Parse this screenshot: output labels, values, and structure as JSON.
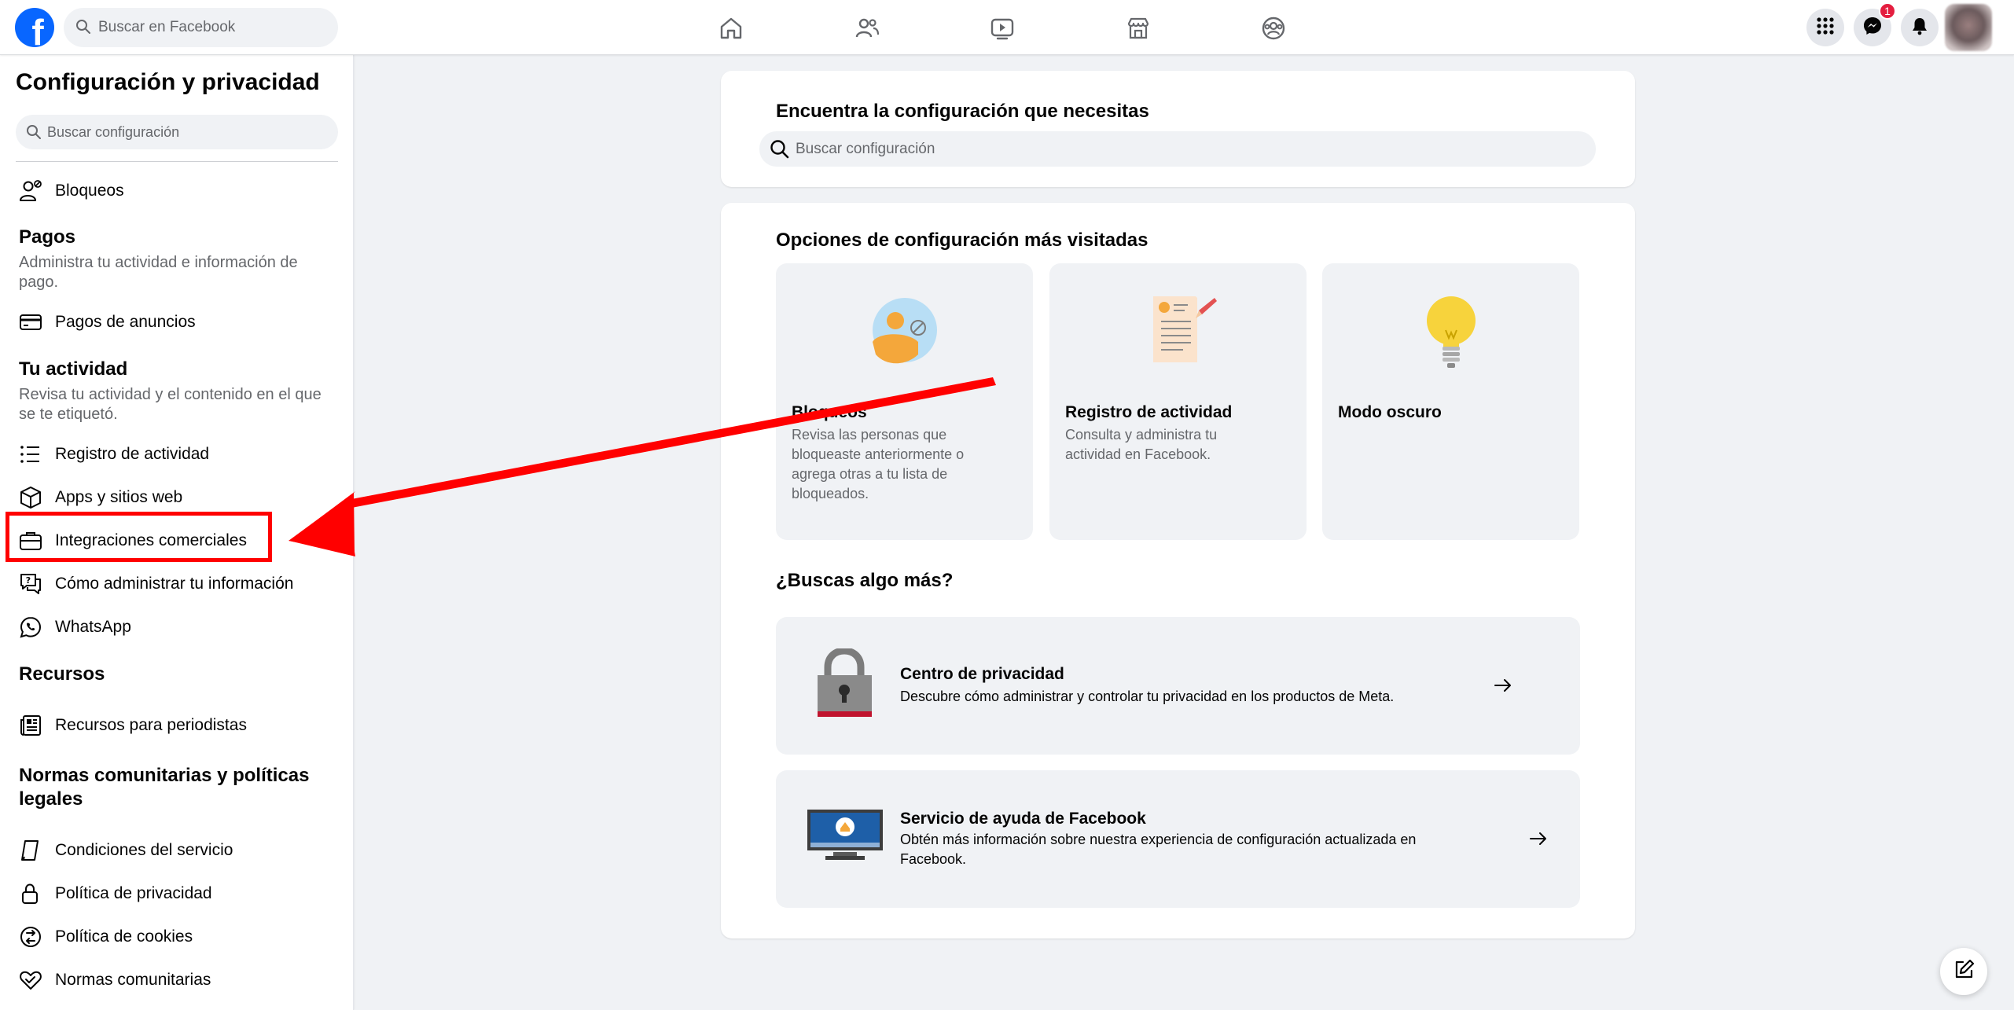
{
  "topbar": {
    "search_placeholder": "Buscar en Facebook",
    "messenger_badge": "1",
    "nav_icons": [
      "home-icon",
      "friends-icon",
      "video-icon",
      "marketplace-icon",
      "groups-icon"
    ]
  },
  "sidebar": {
    "title": "Configuración y privacidad",
    "search_placeholder": "Buscar configuración",
    "items": {
      "bloqueos": "Bloqueos",
      "pagos_section": "Pagos",
      "pagos_desc": "Administra tu actividad e información de pago.",
      "pagos_anuncios": "Pagos de anuncios",
      "actividad_section": "Tu actividad",
      "actividad_desc": "Revisa tu actividad y el contenido en el que se te etiquetó.",
      "registro": "Registro de actividad",
      "apps": "Apps y sitios web",
      "integraciones": "Integraciones comerciales",
      "como_administrar": "Cómo administrar tu información",
      "whatsapp": "WhatsApp",
      "recursos_section": "Recursos",
      "recursos_periodistas": "Recursos para periodistas",
      "normas_section": "Normas comunitarias y políticas legales",
      "condiciones": "Condiciones del servicio",
      "politica_privacidad": "Política de privacidad",
      "politica_cookies": "Política de cookies",
      "normas": "Normas comunitarias"
    }
  },
  "main": {
    "find_title": "Encuentra la configuración que necesitas",
    "find_placeholder": "Buscar configuración",
    "visited_title": "Opciones de configuración más visitadas",
    "tiles": [
      {
        "title": "Bloqueos",
        "desc": "Revisa las personas que bloqueaste anteriormente o agrega otras a tu lista de bloqueados."
      },
      {
        "title": "Registro de actividad",
        "desc": "Consulta y administra tu actividad en Facebook."
      },
      {
        "title": "Modo oscuro",
        "desc": ""
      }
    ],
    "more_title": "¿Buscas algo más?",
    "rows": [
      {
        "title": "Centro de privacidad",
        "desc": "Descubre cómo administrar y controlar tu privacidad en los productos de Meta."
      },
      {
        "title": "Servicio de ayuda de Facebook",
        "desc": "Obtén más información sobre nuestra experiencia de configuración actualizada en Facebook."
      }
    ]
  },
  "colors": {
    "brand": "#0866ff",
    "annotation": "#ff0000",
    "badge": "#e41e3f"
  }
}
